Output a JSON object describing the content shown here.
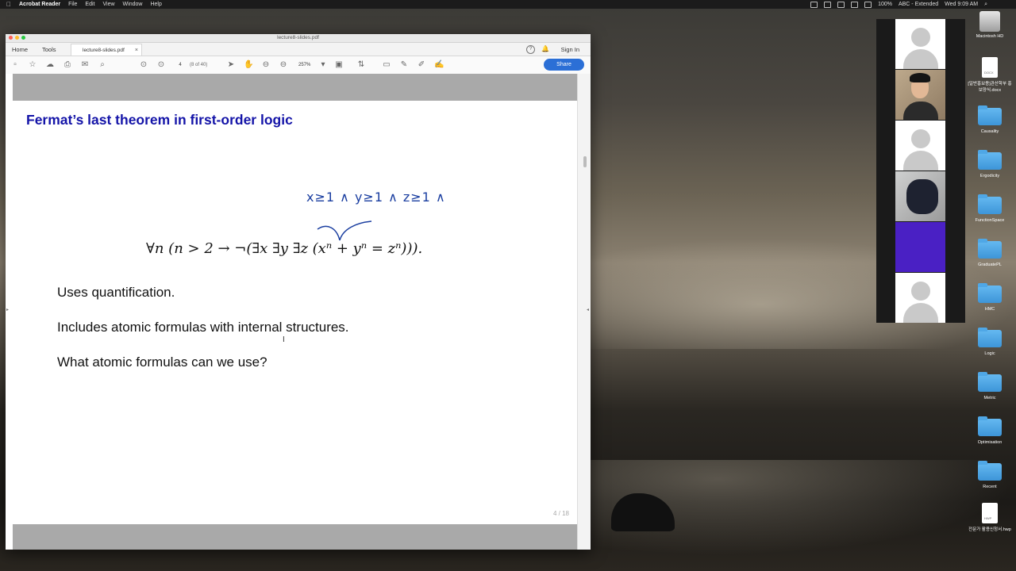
{
  "menubar": {
    "apple": "",
    "app": "Acrobat Reader",
    "menus": [
      "File",
      "Edit",
      "View",
      "Window",
      "Help"
    ],
    "battery": "100%",
    "input_method": "ABC - Extended",
    "clock": "Wed 9:09 AM"
  },
  "window": {
    "title": "lecture8-slides.pdf",
    "nav_home": "Home",
    "nav_tools": "Tools",
    "doc_tab": "lecture8-slides.pdf",
    "sign_in": "Sign In",
    "share": "Share",
    "page_input": "4",
    "page_of": "(8 of 40)",
    "zoom": "257%"
  },
  "slide": {
    "title": "Fermat’s last theorem in first-order logic",
    "formula": "∀n (n > 2 → ¬(∃x ∃y ∃z (xⁿ + yⁿ = zⁿ))).",
    "handwritten_annotation": "x≥1 ∧ y≥1 ∧ z≥1 ∧",
    "bullets": [
      "Uses quantification.",
      "Includes atomic formulas with internal structures.",
      "What atomic formulas can we use?"
    ],
    "page_number": "4 / 18"
  },
  "desktop_icons": [
    {
      "label": "Macintosh HD",
      "kind": "disk"
    },
    {
      "label": "[일반홍보용]관산학부 홍보양식.docx",
      "kind": "docx"
    },
    {
      "label": "Causality",
      "kind": "folder"
    },
    {
      "label": "Ergodicity",
      "kind": "folder"
    },
    {
      "label": "FunctionSpace",
      "kind": "folder"
    },
    {
      "label": "GraduatePL",
      "kind": "folder"
    },
    {
      "label": "HMC",
      "kind": "folder"
    },
    {
      "label": "Logic",
      "kind": "folder"
    },
    {
      "label": "Metric",
      "kind": "folder"
    },
    {
      "label": "Optimisation",
      "kind": "folder"
    },
    {
      "label": "Recent",
      "kind": "folder"
    },
    {
      "label": "전문가 활용신청서.hwp",
      "kind": "hwp"
    }
  ],
  "participants": [
    {
      "kind": "avatar"
    },
    {
      "kind": "camera-person"
    },
    {
      "kind": "avatar"
    },
    {
      "kind": "camera-cloth"
    },
    {
      "kind": "camera-purple"
    },
    {
      "kind": "avatar"
    }
  ]
}
